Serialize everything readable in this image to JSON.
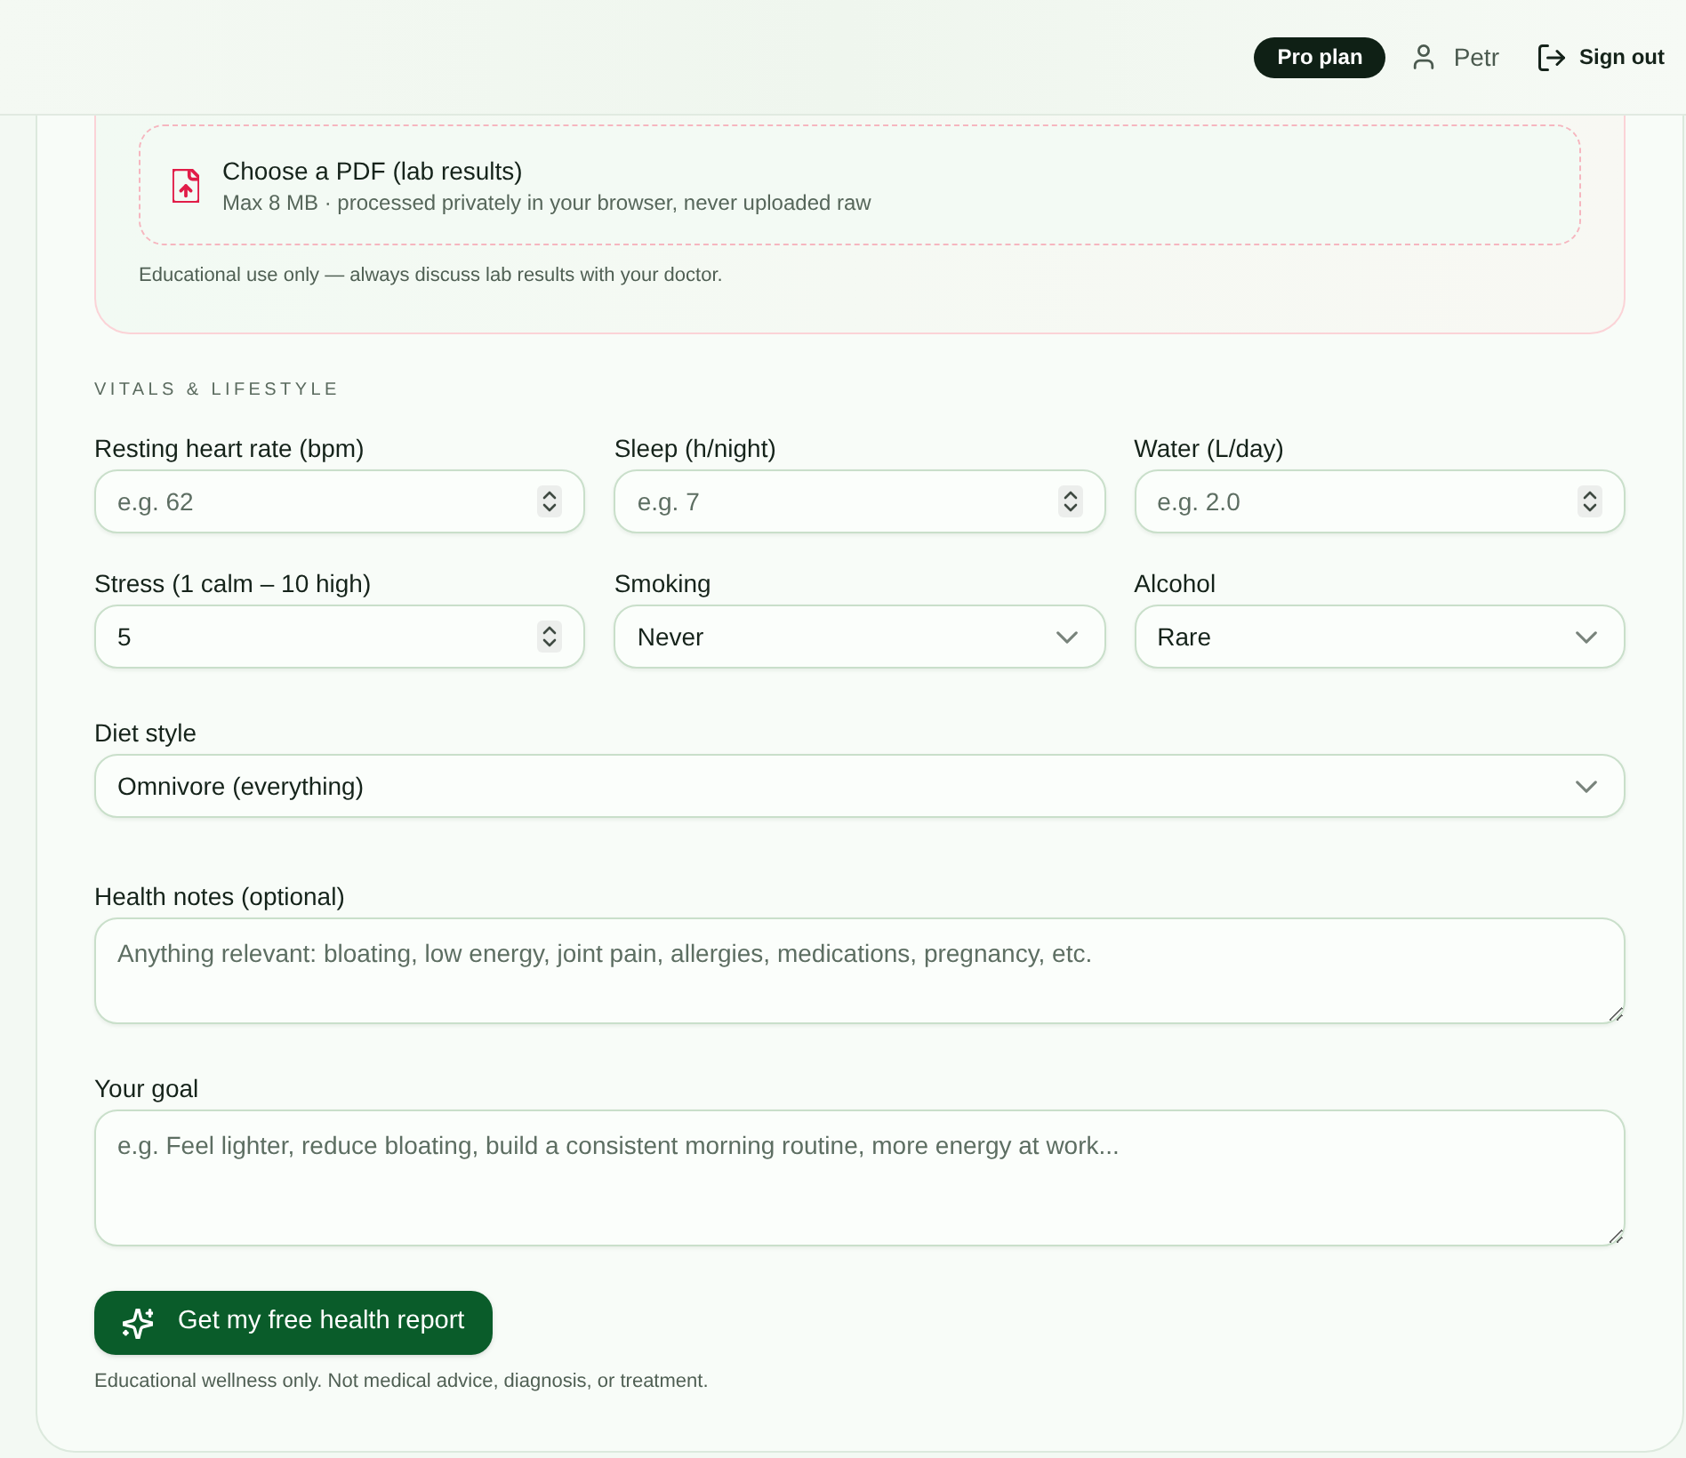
{
  "header": {
    "plan_badge": "Pro plan",
    "user_name": "Petr",
    "sign_out": "Sign out"
  },
  "upload": {
    "title": "Choose a PDF (lab results)",
    "subtitle": "Max 8 MB · processed privately in your browser, never uploaded raw",
    "note": "Educational use only — always discuss lab results with your doctor."
  },
  "section_heading": "VITALS & LIFESTYLE",
  "vitals": [
    {
      "kind": "number",
      "label": "Resting heart rate (bpm)",
      "placeholder": "e.g. 62"
    },
    {
      "kind": "number",
      "label": "Sleep (h/night)",
      "placeholder": "e.g. 7"
    },
    {
      "kind": "number",
      "label": "Water (L/day)",
      "placeholder": "e.g. 2.0"
    },
    {
      "kind": "number",
      "label": "Stress (1 calm – 10 high)",
      "value": "5"
    },
    {
      "kind": "select",
      "label": "Smoking",
      "value": "Never"
    },
    {
      "kind": "select",
      "label": "Alcohol",
      "value": "Rare"
    }
  ],
  "diet_style": {
    "kind": "select",
    "label": "Diet style",
    "value": "Omnivore (everything)"
  },
  "text_areas": [
    {
      "label": "Health notes (optional)",
      "placeholder": "Anything relevant: bloating, low energy, joint pain, allergies, medications, pregnancy, etc."
    },
    {
      "label": "Your goal",
      "placeholder": "e.g. Feel lighter, reduce bloating, build a consistent morning routine, more energy at work..."
    }
  ],
  "submit_button": "Get my free health report",
  "disclaimer": "Educational wellness only. Not medical advice, diagnosis, or treatment."
}
